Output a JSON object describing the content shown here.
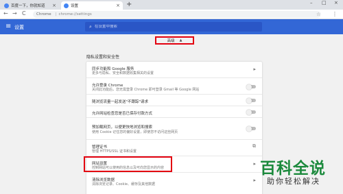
{
  "browser": {
    "tabs": [
      {
        "title": "百度一下，你就知道",
        "close": "×"
      },
      {
        "title": "设置",
        "close": "×"
      }
    ],
    "new_tab_label": "+",
    "window_controls": {
      "minimize": "–",
      "maximize": "□",
      "close": "×"
    },
    "nav": {
      "back": "←",
      "forward": "→",
      "reload": "C"
    },
    "address": {
      "site": "Chrome",
      "separator": "|",
      "url": "chrome://settings"
    },
    "star": "☆",
    "menu": "⋮"
  },
  "settings": {
    "header_title": "设置",
    "menu_icon": "≡",
    "search_icon": "⌕",
    "search_placeholder": "在设置中搜索",
    "advanced_label": "高级",
    "advanced_chevron": "▲",
    "section_title": "隐私设置和安全性",
    "rows": [
      {
        "title": "同步功能和 Google 服务",
        "subtitle": "更多与隐私、安全和数据收集相关的设置",
        "control": "arrow",
        "arrow": "▸"
      },
      {
        "title": "允许登录 Chrome",
        "subtitle": "关闭此功能后，您无需登录 Chrome 即可登录 Gmail 等 Google 网站",
        "control": "toggle",
        "toggle_on": false
      },
      {
        "title": "随浏览流量一起发送\"不跟踪\"请求",
        "subtitle": "",
        "control": "toggle",
        "toggle_on": false
      },
      {
        "title": "允许网站检查您是否已保存付款方式",
        "subtitle": "",
        "control": "toggle",
        "toggle_on": false
      },
      {
        "title": "预加载网页，以便更快地浏览和搜索",
        "subtitle": "使用 Cookie 记住您的偏好设置，即使您不访问这些网页",
        "control": "toggle",
        "toggle_on": false
      },
      {
        "title": "管理证书",
        "subtitle": "管理 HTTPS/SSL 证书和设置",
        "control": "external",
        "arrow": "⧉"
      },
      {
        "title": "网站设置",
        "subtitle": "控制网站可以使用的信息以及可向您显示的内容",
        "control": "arrow",
        "arrow": "▸"
      },
      {
        "title": "清除浏览数据",
        "subtitle": "清除浏览记录、Cookie、缓存及其他数据",
        "control": "arrow",
        "arrow": "▸"
      }
    ]
  },
  "watermark": {
    "main": "百科全说",
    "sub": "助你轻松解决"
  },
  "colors": {
    "header": "#3367d6",
    "highlight": "#e3000f",
    "watermark": "#1c8a3d"
  }
}
